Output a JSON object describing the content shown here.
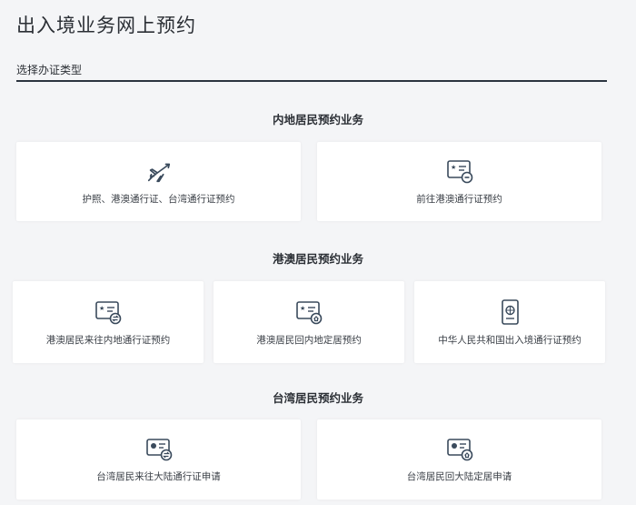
{
  "page": {
    "title": "出入境业务网上预约"
  },
  "tabs": [
    {
      "label": "选择办证类型"
    }
  ],
  "sections": [
    {
      "title": "内地居民预约业务",
      "cards": [
        {
          "label": "护照、港澳通行证、台湾通行证预约",
          "icon": "airplane-icon"
        },
        {
          "label": "前往港澳通行证预约",
          "icon": "card-minus-icon"
        }
      ]
    },
    {
      "title": "港澳居民预约业务",
      "cards": [
        {
          "label": "港澳居民来往内地通行证预约",
          "icon": "card-exchange-icon"
        },
        {
          "label": "港澳居民回内地定居预约",
          "icon": "card-home-icon"
        },
        {
          "label": "中华人民共和国出入境通行证预约",
          "icon": "passport-icon"
        }
      ]
    },
    {
      "title": "台湾居民预约业务",
      "cards": [
        {
          "label": "台湾居民来往大陆通行证申请",
          "icon": "id-card-exchange-icon"
        },
        {
          "label": "台湾居民回大陆定居申请",
          "icon": "id-card-home-icon"
        }
      ]
    }
  ],
  "colors": {
    "background": "#f4f5f7",
    "card": "#ffffff",
    "text": "#2b2f35",
    "underline": "#2c3440"
  }
}
